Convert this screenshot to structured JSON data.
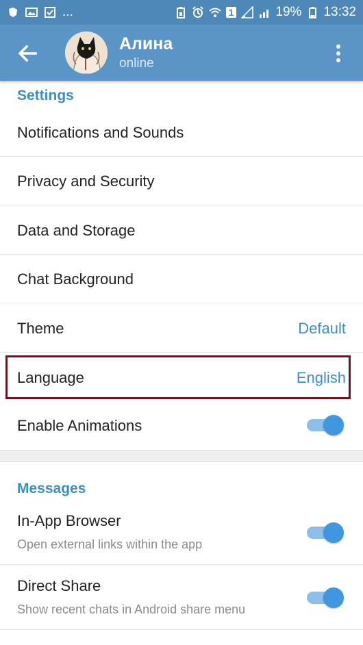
{
  "status_bar": {
    "battery_percent": "19%",
    "time": "13:32",
    "sim_badge": "1",
    "more": "..."
  },
  "header": {
    "title": "Алина",
    "subtitle": "online"
  },
  "settings": {
    "section_title": "Settings",
    "items": [
      {
        "label": "Notifications and Sounds"
      },
      {
        "label": "Privacy and Security"
      },
      {
        "label": "Data and Storage"
      },
      {
        "label": "Chat Background"
      },
      {
        "label": "Theme",
        "value": "Default"
      },
      {
        "label": "Language",
        "value": "English"
      },
      {
        "label": "Enable Animations",
        "toggle": true
      }
    ]
  },
  "messages": {
    "section_title": "Messages",
    "items": [
      {
        "label": "In-App Browser",
        "sub": "Open external links within the app",
        "toggle": true
      },
      {
        "label": "Direct Share",
        "sub": "Show recent chats in Android share menu",
        "toggle": true
      }
    ]
  },
  "colors": {
    "app_bar": "#5b95c8",
    "accent": "#3a8fc6",
    "highlight_border": "#6b1424"
  }
}
